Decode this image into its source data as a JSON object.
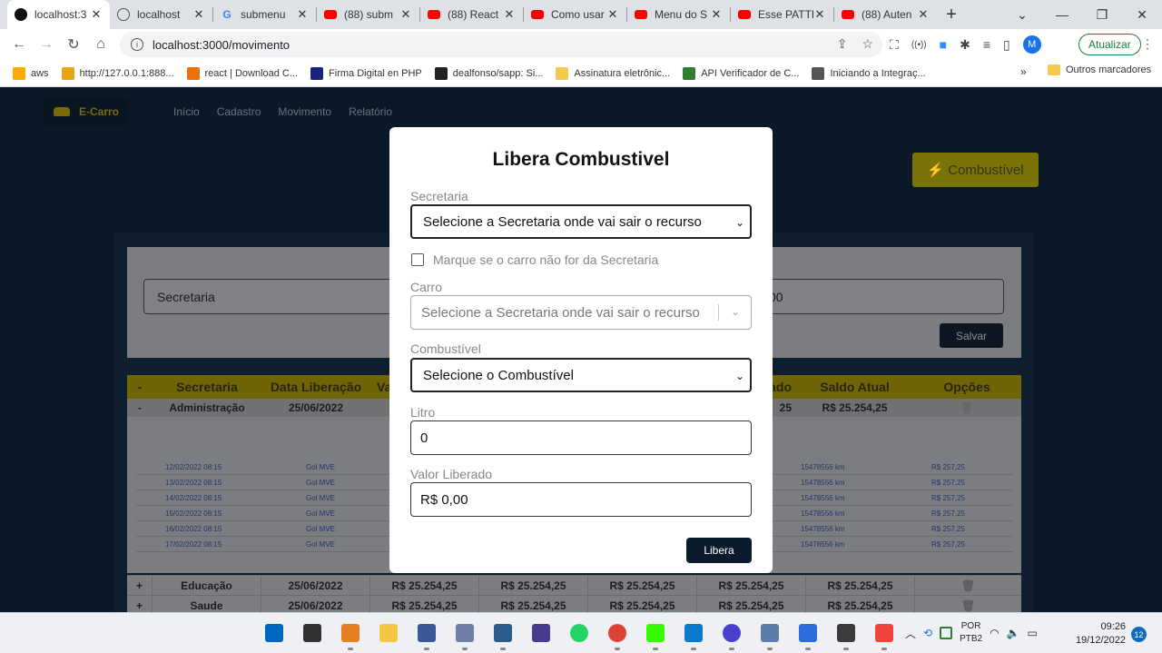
{
  "browser": {
    "tabs": [
      {
        "title": "localhost:3",
        "icon": "react-icon",
        "active": true
      },
      {
        "title": "localhost",
        "icon": "globe-icon"
      },
      {
        "title": "submenu",
        "icon": "google-icon"
      },
      {
        "title": "(88) subm",
        "icon": "youtube-icon"
      },
      {
        "title": "(88) React",
        "icon": "youtube-icon"
      },
      {
        "title": "Como usar",
        "icon": "youtube-icon"
      },
      {
        "title": "Menu do S",
        "icon": "youtube-icon"
      },
      {
        "title": "Esse PATTE",
        "icon": "youtube-icon"
      },
      {
        "title": "(88) Auten",
        "icon": "youtube-icon"
      }
    ],
    "url": "localhost:3000/movimento",
    "update_label": "Atualizar",
    "avatar_letter": "M",
    "bookmarks": [
      {
        "label": "aws",
        "color": "#f9ab00"
      },
      {
        "label": "http://127.0.0.1:888...",
        "color": "#e8a317"
      },
      {
        "label": "react | Download C...",
        "color": "#e8710a"
      },
      {
        "label": "Firma Digital en PHP",
        "color": "#1a237e"
      },
      {
        "label": "dealfonso/sapp: Si...",
        "color": "#222222"
      },
      {
        "label": "Assinatura eletrônic...",
        "color": "#f2c94c"
      },
      {
        "label": "API Verificador de C...",
        "color": "#2e7d32"
      },
      {
        "label": "Iniciando a Integraç...",
        "color": "#555555"
      }
    ],
    "bookmarks_more": "»",
    "other_bookmarks": "Outros marcadores"
  },
  "app": {
    "brand": "E-Carro",
    "nav": [
      "Início",
      "Cadastro",
      "Movimento",
      "Relatório"
    ],
    "fuel_button": "⚡ Combustível",
    "secretaria_field": "Secretaria",
    "valor_field": "00",
    "save_label": "Salvar",
    "table_headers": [
      "-",
      "Secretaria",
      "Data Liberação",
      "Va",
      "",
      "",
      "ado",
      "Saldo Atual",
      "Opções"
    ],
    "expanded_row": {
      "toggle": "-",
      "secretaria": "Administração",
      "data": "25/06/2022",
      "c6": "25",
      "saldo": "R$ 25.254,25"
    },
    "sub_rows": [
      {
        "date": "12/02/2022 08:15",
        "car": "Gol MVE",
        "km": "15478556 km",
        "value": "R$ 257,25"
      },
      {
        "date": "13/02/2022 08:15",
        "car": "Gol MVE",
        "km": "15478556 km",
        "value": "R$ 257,25"
      },
      {
        "date": "14/02/2022 08:15",
        "car": "Gol MVE",
        "km": "15478556 km",
        "value": "R$ 257,25"
      },
      {
        "date": "15/02/2022 08:15",
        "car": "Gol MVE",
        "km": "15478556 km",
        "value": "R$ 257,25"
      },
      {
        "date": "16/02/2022 08:15",
        "car": "Gol MVE",
        "km": "15478556 km",
        "value": "R$ 257,25"
      },
      {
        "date": "17/02/2022 08:15",
        "car": "Gol MVE",
        "km": "15478556 km",
        "value": "R$ 257,25"
      }
    ],
    "bottom_rows": [
      {
        "toggle": "+",
        "secretaria": "Educação",
        "data": "25/06/2022",
        "v1": "R$ 25.254,25",
        "v2": "R$ 25.254,25",
        "v3": "R$ 25.254,25",
        "v4": "R$ 25.254,25",
        "saldo": "R$ 25.254,25"
      },
      {
        "toggle": "+",
        "secretaria": "Saude",
        "data": "25/06/2022",
        "v1": "R$ 25.254,25",
        "v2": "R$ 25.254,25",
        "v3": "R$ 25.254,25",
        "v4": "R$ 25.254,25",
        "saldo": "R$ 25.254,25"
      }
    ]
  },
  "modal": {
    "title": "Libera Combustivel",
    "secretaria_label": "Secretaria",
    "secretaria_value": "Selecione a Secretaria onde vai sair o recurso",
    "checkbox_label": "Marque se o carro não for da Secretaria",
    "carro_label": "Carro",
    "carro_placeholder": "Selecione a Secretaria onde vai sair o recurso",
    "combustivel_label": "Combustível",
    "combustivel_value": "Selecione o Combustível",
    "litro_label": "Litro",
    "litro_value": "0",
    "valor_label": "Valor Liberado",
    "valor_value": "R$ 0,00",
    "submit_label": "Libera"
  },
  "taskbar": {
    "lang_top": "POR",
    "lang_bottom": "PTB2",
    "time": "09:26",
    "date": "19/12/2022",
    "notifications": "12",
    "apps": [
      {
        "name": "windows-start-icon",
        "color": "#0067c0"
      },
      {
        "name": "task-view-icon",
        "color": "#333333"
      },
      {
        "name": "app-icon-1",
        "color": "#e67e22"
      },
      {
        "name": "file-explorer-icon",
        "color": "#f4c542"
      },
      {
        "name": "network-app-icon",
        "color": "#3b5998"
      },
      {
        "name": "remote-app-icon",
        "color": "#6f7fa8"
      },
      {
        "name": "editor-app-icon",
        "color": "#2c5d8a"
      },
      {
        "name": "jw-app-icon",
        "color": "#4a3b8c"
      },
      {
        "name": "whatsapp-icon",
        "color": "#25d366"
      },
      {
        "name": "chrome-icon",
        "color": "#db4437"
      },
      {
        "name": "dreamweaver-icon",
        "color": "#35fa00"
      },
      {
        "name": "vscode-icon",
        "color": "#0a7acc"
      },
      {
        "name": "app-icon-2",
        "color": "#4b3fd0"
      },
      {
        "name": "app-icon-3",
        "color": "#5c7ea8"
      },
      {
        "name": "notepad-icon",
        "color": "#2d6cdf"
      },
      {
        "name": "calculator-icon",
        "color": "#3c3c3c"
      },
      {
        "name": "anydesk-icon",
        "color": "#ef443b"
      }
    ]
  }
}
